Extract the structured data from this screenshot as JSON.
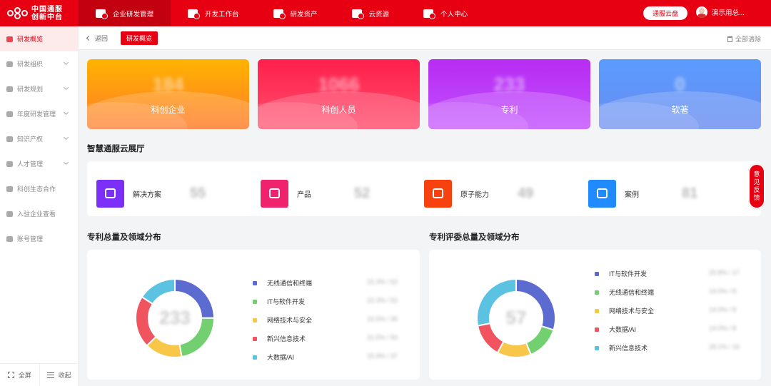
{
  "logo": {
    "line1": "中国通服",
    "line2": "创新中台"
  },
  "nav": [
    {
      "label": "企业研发管理",
      "icon": "building-icon"
    },
    {
      "label": "开发工作台",
      "icon": "monitor-icon"
    },
    {
      "label": "研发资产",
      "icon": "gear-icon"
    },
    {
      "label": "云资源",
      "icon": "cloud-icon"
    },
    {
      "label": "个人中心",
      "icon": "person-icon"
    }
  ],
  "header": {
    "cloud_button": "通服云盘",
    "user_name": "演示用总..."
  },
  "sidebar": {
    "items": [
      {
        "label": "研发概览",
        "active": true,
        "expandable": false
      },
      {
        "label": "研发组织",
        "active": false,
        "expandable": true
      },
      {
        "label": "研发规划",
        "active": false,
        "expandable": true
      },
      {
        "label": "年度研发管理",
        "active": false,
        "expandable": true
      },
      {
        "label": "知识产权",
        "active": false,
        "expandable": true
      },
      {
        "label": "人才管理",
        "active": false,
        "expandable": true
      },
      {
        "label": "科创生态合作",
        "active": false,
        "expandable": false
      },
      {
        "label": "入驻企业查看",
        "active": false,
        "expandable": false
      },
      {
        "label": "账号管理",
        "active": false,
        "expandable": false
      }
    ],
    "fullscreen": "全屏",
    "collapse": "收起"
  },
  "subbar": {
    "back": "返回",
    "tag": "研发概览",
    "clear": "全部清除"
  },
  "stats": [
    {
      "label": "科创企业",
      "value": "184"
    },
    {
      "label": "科创人员",
      "value": "1066"
    },
    {
      "label": "专利",
      "value": "233"
    },
    {
      "label": "软著",
      "value": "0"
    }
  ],
  "expo": {
    "title": "智慧通服云展厅",
    "items": [
      {
        "label": "解决方案",
        "value": "55",
        "color": "#7b2ff7"
      },
      {
        "label": "产品",
        "value": "52",
        "color": "#f0226e"
      },
      {
        "label": "原子能力",
        "value": "49",
        "color": "#f7410f"
      },
      {
        "label": "案例",
        "value": "81",
        "color": "#1f8bff"
      }
    ]
  },
  "feedback": [
    "意",
    "见",
    "反",
    "馈"
  ],
  "patent_total": {
    "title": "专利总量及领域分布",
    "total": "233",
    "segments": [
      {
        "name": "无线通信和终端",
        "value": 58,
        "color": "#5b6bd0"
      },
      {
        "name": "IT与软件开发",
        "value": 52,
        "color": "#72d070"
      },
      {
        "name": "网络技术与安全",
        "value": 36,
        "color": "#f8c74a"
      },
      {
        "name": "新兴信息技术",
        "value": 50,
        "color": "#f0555f"
      },
      {
        "name": "大数据/AI",
        "value": 37,
        "color": "#5bc3e1"
      }
    ],
    "legend_values": [
      "22.3% / 52",
      "22.3% / 52",
      "15.5% / 36",
      "21.5% / 50",
      "15.9% / 37"
    ]
  },
  "patent_review": {
    "title": "专利评委总量及领域分布",
    "total": "57",
    "segments": [
      {
        "name": "IT与软件开发",
        "value": 17,
        "color": "#5b6bd0"
      },
      {
        "name": "无线通信和终端",
        "value": 8,
        "color": "#72d070"
      },
      {
        "name": "网络技术与安全",
        "value": 8,
        "color": "#f8c74a"
      },
      {
        "name": "大数据/AI",
        "value": 8,
        "color": "#f0555f"
      },
      {
        "name": "新兴信息技术",
        "value": 16,
        "color": "#5bc3e1"
      }
    ],
    "legend_values": [
      "29.8% / 17",
      "14.0% / 8",
      "14.0% / 8",
      "14.0% / 8",
      "28.1% / 16"
    ]
  }
}
